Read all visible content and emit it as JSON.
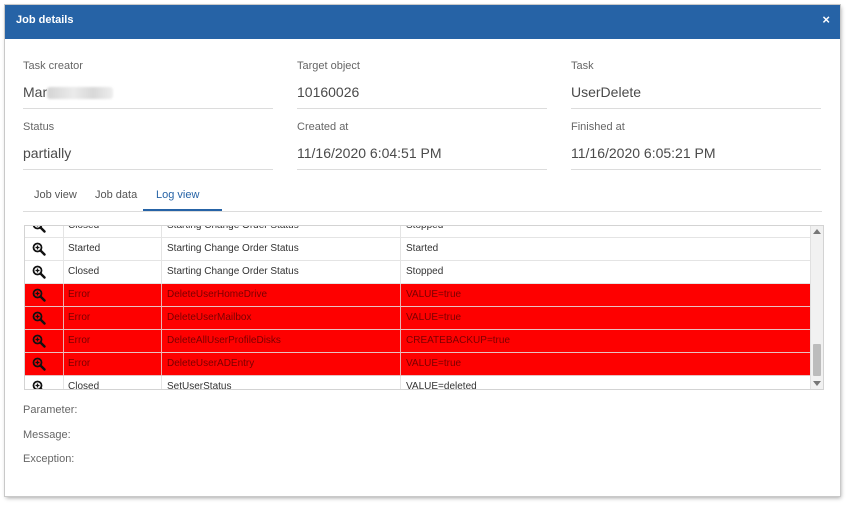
{
  "window": {
    "title": "Job details",
    "close_label": "×"
  },
  "fields": {
    "task_creator": {
      "label": "Task creator",
      "value_visible": "Mar"
    },
    "target_object": {
      "label": "Target object",
      "value": "10160026"
    },
    "task": {
      "label": "Task",
      "value": "UserDelete"
    },
    "status": {
      "label": "Status",
      "value": "partially"
    },
    "created_at": {
      "label": "Created at",
      "value": "11/16/2020 6:04:51 PM"
    },
    "finished_at": {
      "label": "Finished at",
      "value": "11/16/2020 6:05:21 PM"
    }
  },
  "tabs": [
    {
      "label": "Job view"
    },
    {
      "label": "Job data"
    },
    {
      "label": "Log view"
    }
  ],
  "log_rows": [
    {
      "status": "Closed",
      "action": "Starting Change Order Status",
      "value": "Stopped",
      "error": false
    },
    {
      "status": "Started",
      "action": "Starting Change Order Status",
      "value": "Started",
      "error": false
    },
    {
      "status": "Closed",
      "action": "Starting Change Order Status",
      "value": "Stopped",
      "error": false
    },
    {
      "status": "Error",
      "action": "DeleteUserHomeDrive",
      "value": "VALUE=true",
      "error": true
    },
    {
      "status": "Error",
      "action": "DeleteUserMailbox",
      "value": "VALUE=true",
      "error": true
    },
    {
      "status": "Error",
      "action": "DeleteAllUserProfileDisks",
      "value": "CREATEBACKUP=true",
      "error": true
    },
    {
      "status": "Error",
      "action": "DeleteUserADEntry",
      "value": "VALUE=true",
      "error": true
    },
    {
      "status": "Closed",
      "action": "SetUserStatus",
      "value": "VALUE=deleted",
      "error": false
    }
  ],
  "details": {
    "parameter_label": "Parameter:",
    "message_label": "Message:",
    "exception_label": "Exception:"
  },
  "icons": {
    "row_action": "zoom-in-icon",
    "close": "close-icon"
  },
  "colors": {
    "titlebar": "#2663a6",
    "error_row": "#fe0000",
    "active_tab": "#2663a6"
  }
}
